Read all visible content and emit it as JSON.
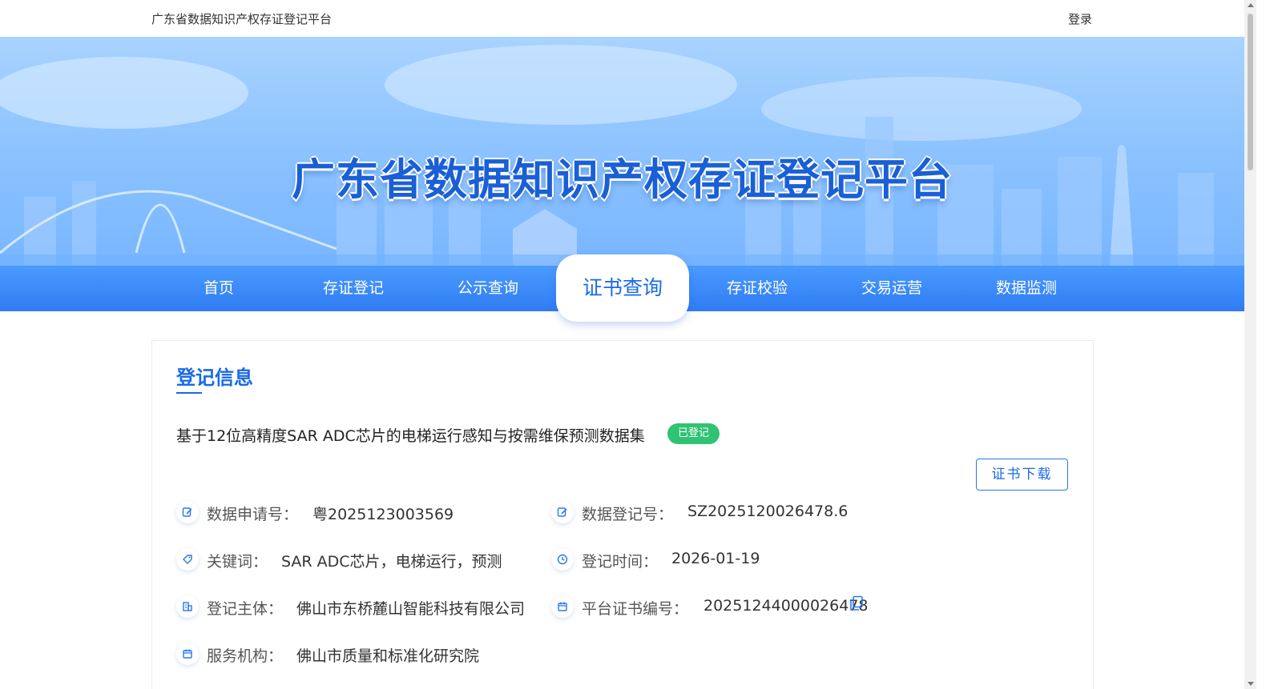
{
  "header": {
    "site_name": "广东省数据知识产权存证登记平台",
    "login_label": "登录"
  },
  "banner": {
    "title": "广东省数据知识产权存证登记平台"
  },
  "nav": {
    "items": [
      {
        "label": "首页",
        "active": false
      },
      {
        "label": "存证登记",
        "active": false
      },
      {
        "label": "公示查询",
        "active": false
      },
      {
        "label": "证书查询",
        "active": true
      },
      {
        "label": "存证校验",
        "active": false
      },
      {
        "label": "交易运营",
        "active": false
      },
      {
        "label": "数据监测",
        "active": false
      }
    ]
  },
  "record": {
    "section_title": "登记信息",
    "title": "基于12位高精度SAR ADC芯片的电梯运行感知与按需维保预测数据集",
    "status_badge": "已登记",
    "download_label": "证书下载",
    "fields": {
      "application_no": {
        "label": "数据申请号：",
        "value": "粤2025123003569",
        "icon": "edit-icon"
      },
      "registration_no": {
        "label": "数据登记号：",
        "value": "SZ2025120026478.6",
        "icon": "edit-icon"
      },
      "keywords": {
        "label": "关键词：",
        "value": "SAR ADC芯片，电梯运行，预测",
        "icon": "tag-icon"
      },
      "registration_time": {
        "label": "登记时间：",
        "value": "2026-01-19",
        "icon": "clock-icon"
      },
      "registrant": {
        "label": "登记主体：",
        "value": "佛山市东桥麓山智能科技有限公司",
        "icon": "building-icon"
      },
      "certificate_no": {
        "label": "平台证书编号：",
        "value": "20251244000026478",
        "icon": "calendar-icon"
      },
      "service_org": {
        "label": "服务机构：",
        "value": "佛山市质量和标准化研究院",
        "icon": "calendar-icon"
      }
    }
  },
  "colors": {
    "primary": "#1a6ae6",
    "nav_bg": "#2f7cf2",
    "badge_green": "#2fc373"
  }
}
